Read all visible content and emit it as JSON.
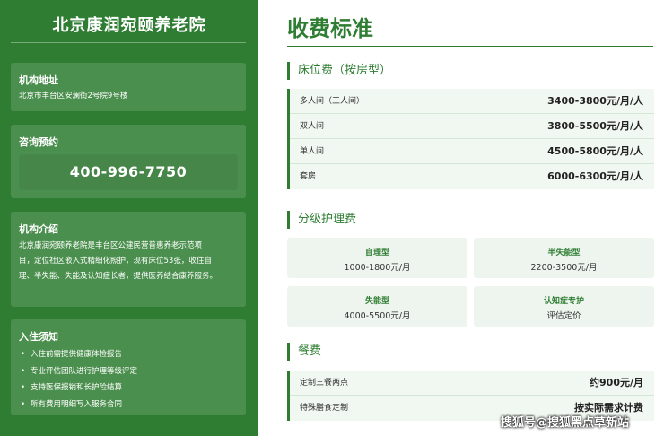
{
  "sidebar": {
    "title": "北京康润宛颐养老院",
    "address": {
      "heading": "机构地址",
      "text": "北京市丰台区安澜街2号院9号楼"
    },
    "consult": {
      "heading": "咨询预约",
      "phone": "400-996-7750"
    },
    "intro": {
      "heading": "机构介绍",
      "lines": [
        "北京康润宛颐养老院是丰台区公建民营普惠养老示范项",
        "目，定位社区嵌入式精细化照护，现有床位53张，收住自",
        "理、半失能、失能及认知症长者，提供医养结合康养服务。"
      ]
    },
    "notice": {
      "heading": "入住须知",
      "items": [
        "入住前需提供健康体检报告",
        "专业评估团队进行护理等级评定",
        "支持医保报销和长护险结算",
        "所有费用明细写入服务合同"
      ]
    }
  },
  "main": {
    "title": "收费标准",
    "bed": {
      "heading": "床位费（按房型）",
      "rows": [
        {
          "label": "多人间（三人间）",
          "price": "3400-3800元/月/人"
        },
        {
          "label": "双人间",
          "price": "3800-5500元/月/人"
        },
        {
          "label": "单人间",
          "price": "4500-5800元/月/人"
        },
        {
          "label": "套房",
          "price": "6000-6300元/月/人"
        }
      ]
    },
    "care": {
      "heading": "分级护理费",
      "cards": [
        {
          "name": "自理型",
          "price": "1000-1800元/月"
        },
        {
          "name": "半失能型",
          "price": "2200-3500元/月"
        },
        {
          "name": "失能型",
          "price": "4000-5500元/月"
        },
        {
          "name": "认知症专护",
          "price": "评估定价"
        }
      ]
    },
    "meal": {
      "heading": "餐费",
      "rows": [
        {
          "label": "定制三餐两点",
          "price": "约900元/月"
        },
        {
          "label": "特殊膳食定制",
          "price": "按实际需求计费"
        }
      ]
    }
  },
  "watermark": "搜狐号@搜狐黑点草新站"
}
